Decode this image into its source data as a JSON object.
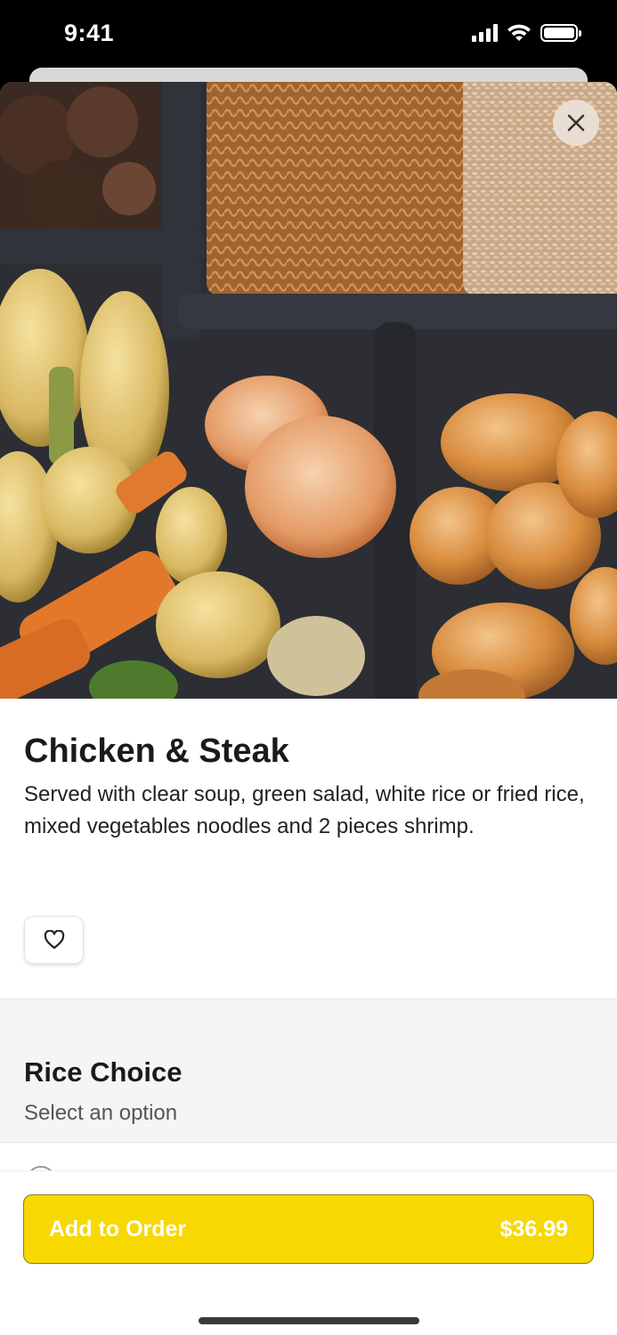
{
  "status_bar": {
    "time": "9:41"
  },
  "item": {
    "title": "Chicken & Steak",
    "description": "Served with clear soup, green salad, white rice or fried rice, mixed vegetables noodles and 2 pieces shrimp."
  },
  "rice_choice": {
    "title": "Rice Choice",
    "subtitle": "Select an option"
  },
  "order_button": {
    "label": "Add to Order",
    "price": "$36.99"
  },
  "colors": {
    "accent": "#f7d800",
    "hero_dark": "#2a2a2e"
  },
  "icons": {
    "close": "close-icon",
    "favorite": "heart-icon"
  }
}
